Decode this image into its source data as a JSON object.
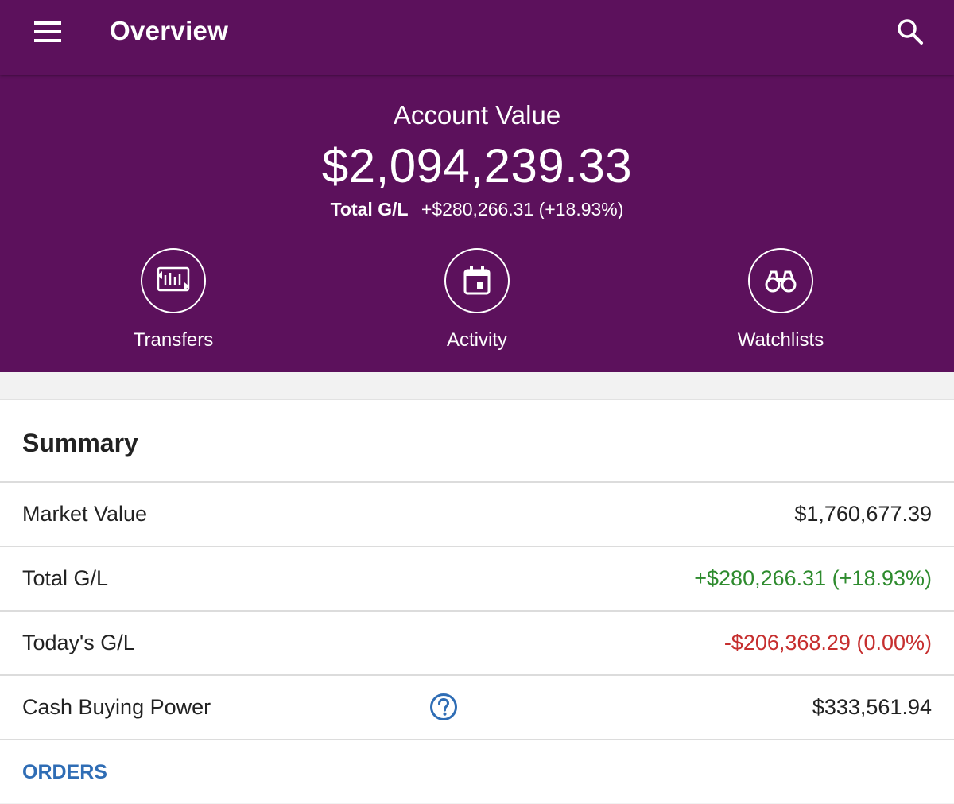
{
  "app_bar": {
    "title": "Overview",
    "menu_icon": "hamburger-menu-icon",
    "search_icon": "search-icon"
  },
  "account": {
    "label": "Account Value",
    "value": "$2,094,239.33",
    "total_gl_label": "Total G/L",
    "total_gl_value": "+$280,266.31 (+18.93%)"
  },
  "actions": [
    {
      "label": "Transfers",
      "icon": "transfers-icon"
    },
    {
      "label": "Activity",
      "icon": "calendar-icon"
    },
    {
      "label": "Watchlists",
      "icon": "binoculars-icon"
    }
  ],
  "summary": {
    "title": "Summary",
    "rows": [
      {
        "label": "Market Value",
        "value": "$1,760,677.39"
      },
      {
        "label": "Total G/L",
        "value": "+$280,266.31 (+18.93%)"
      },
      {
        "label": "Today's G/L",
        "value": "-$206,368.29 (0.00%)"
      },
      {
        "label": "Cash Buying Power",
        "value": "$333,561.94"
      }
    ],
    "orders_link": "ORDERS"
  },
  "colors": {
    "brand_purple": "#5c115c",
    "gain_green": "#2e8b2e",
    "loss_red": "#c62f2f",
    "link_blue": "#2f6db5"
  }
}
